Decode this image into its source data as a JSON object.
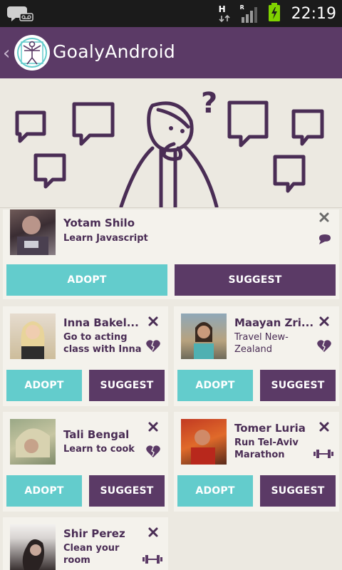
{
  "status_bar": {
    "time": "22:19",
    "network_type": "H",
    "roaming": "R"
  },
  "action_bar": {
    "back": "‹",
    "title": "GoalyAndroid"
  },
  "hero": {
    "question_mark": "?"
  },
  "buttons": {
    "adopt": "ADOPT",
    "suggest": "SUGGEST"
  },
  "goals": [
    {
      "name": "Yotam Shilo",
      "goal": "Learn Javascript",
      "category_icon": "speech-bubble-icon"
    },
    {
      "name": "Inna Bakel...",
      "goal": "Go to acting class with Inna",
      "category_icon": "heart-icon"
    },
    {
      "name": "Maayan Zri...",
      "goal": "Travel New-Zealand",
      "category_icon": "heart-icon"
    },
    {
      "name": "Tali Bengal",
      "goal": "Learn to cook",
      "category_icon": "heart-icon"
    },
    {
      "name": "Tomer Luria",
      "goal": "Run Tel-Aviv Marathon",
      "category_icon": "dumbbell-icon"
    },
    {
      "name": "Shir Perez",
      "goal": "Clean your room",
      "category_icon": "dumbbell-icon"
    }
  ],
  "colors": {
    "purple": "#5b3a66",
    "teal": "#63cccc",
    "background": "#ece9e1",
    "card": "#f4f2ec"
  }
}
